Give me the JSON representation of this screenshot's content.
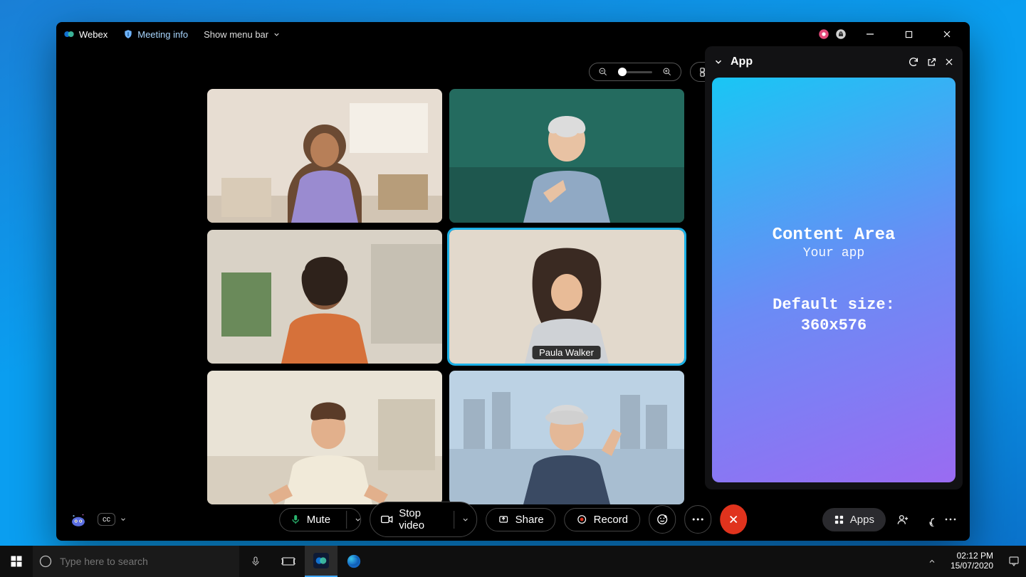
{
  "titlebar": {
    "brand": "Webex",
    "meeting_info": "Meeting info",
    "show_menubar": "Show menu bar"
  },
  "top": {
    "layout": "Layout"
  },
  "participants": {
    "active_name": "Paula Walker"
  },
  "panel": {
    "title": "App",
    "content_heading": "Content Area",
    "content_sub": "Your app",
    "default_size_label": "Default size:",
    "default_size_value": "360x576"
  },
  "controls": {
    "mute": "Mute",
    "stop_video": "Stop video",
    "share": "Share",
    "record": "Record",
    "apps": "Apps"
  },
  "taskbar": {
    "search_placeholder": "Type here to search",
    "time": "02:12 PM",
    "date": "15/07/2020"
  }
}
